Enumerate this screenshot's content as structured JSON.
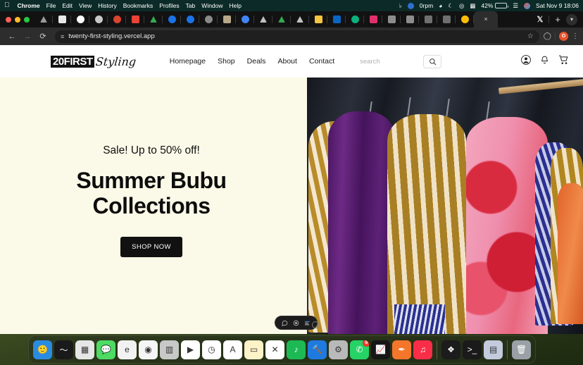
{
  "menubar": {
    "apple_icon": "apple-logo",
    "items": [
      "Chrome",
      "File",
      "Edit",
      "View",
      "History",
      "Bookmarks",
      "Profiles",
      "Tab",
      "Window",
      "Help"
    ],
    "status": {
      "music_rate": "0rpm",
      "battery_percent": "42%",
      "datetime": "Sat Nov 9  18:06",
      "icons": [
        "music-note-icon",
        "stats-icon",
        "clock-icon",
        "moon-icon",
        "record-icon",
        "keyboard-icon",
        "battery-icon",
        "display-icon",
        "control-center-icon"
      ]
    }
  },
  "browser": {
    "window_controls": [
      "close",
      "minimize",
      "zoom"
    ],
    "tabs": [
      {
        "name": "tab-apple",
        "color": "#9a9a9a",
        "shape": "triangle"
      },
      {
        "name": "tab-news",
        "color": "#e8e8e8",
        "shape": "square"
      },
      {
        "name": "tab-github",
        "color": "#ffffff",
        "shape": "circle"
      },
      {
        "name": "tab-app",
        "color": "#c8c8c8",
        "shape": "circle"
      },
      {
        "name": "tab-opera",
        "color": "#d8452f",
        "shape": "circle"
      },
      {
        "name": "tab-gmail",
        "color": "#ea4335",
        "shape": "square"
      },
      {
        "name": "tab-drive",
        "color": "#34a853",
        "shape": "triangle"
      },
      {
        "name": "tab-loop",
        "color": "#1a73e8",
        "shape": "circle"
      },
      {
        "name": "tab-loop2",
        "color": "#1a73e8",
        "shape": "circle"
      },
      {
        "name": "tab-gray",
        "color": "#8a8a8a",
        "shape": "circle"
      },
      {
        "name": "tab-photo",
        "color": "#b8a88a",
        "shape": "square"
      },
      {
        "name": "tab-chrome",
        "color": "#4285f4",
        "shape": "circle"
      },
      {
        "name": "tab-apple2",
        "color": "#c0c0c0",
        "shape": "triangle"
      },
      {
        "name": "tab-drive2",
        "color": "#34a853",
        "shape": "triangle"
      },
      {
        "name": "tab-apple3",
        "color": "#c0c0c0",
        "shape": "triangle"
      },
      {
        "name": "tab-note",
        "color": "#f5c542",
        "shape": "square"
      },
      {
        "name": "tab-linkedin",
        "color": "#0a66c2",
        "shape": "square"
      },
      {
        "name": "tab-hubspot",
        "color": "#0bb07b",
        "shape": "circle"
      },
      {
        "name": "tab-instagram",
        "color": "#e1306c",
        "shape": "square"
      },
      {
        "name": "tab-vp",
        "color": "#8d8d8d",
        "shape": "square"
      },
      {
        "name": "tab-vp2",
        "color": "#8d8d8d",
        "shape": "square"
      },
      {
        "name": "tab-dark1",
        "color": "#6f6f6f",
        "shape": "square"
      },
      {
        "name": "tab-dark2",
        "color": "#6f6f6f",
        "shape": "square"
      },
      {
        "name": "tab-google-photos",
        "color": "#fbbc04",
        "shape": "circle"
      }
    ],
    "active_tab_close_label": "×",
    "x_tab_label": "𝕏",
    "new_tab_label": "+",
    "tab_list_chevron": "▾",
    "nav": {
      "back": "←",
      "forward": "→",
      "reload": "⟳"
    },
    "omnibox": {
      "site_settings_icon": "tune-icon",
      "url": "twenty-first-styling.vercel.app",
      "bookmark_icon": "star-icon"
    },
    "toolbar_right": {
      "extensions_icon": "puzzle-icon",
      "profile_initial": "O",
      "menu_icon": "kebab-menu-icon"
    }
  },
  "site": {
    "logo": {
      "block_text": "20FIRST",
      "script_text": "Styling"
    },
    "nav_links": [
      "Homepage",
      "Shop",
      "Deals",
      "About",
      "Contact"
    ],
    "search": {
      "value": "",
      "placeholder": "search",
      "button_icon": "search-icon"
    },
    "header_icons": [
      "account-icon",
      "notification-bell-icon",
      "shopping-cart-icon"
    ],
    "hero": {
      "eyebrow": "Sale! Up to 50% off!",
      "title": "Summer Bubu Collections",
      "cta_label": "SHOP NOW",
      "bg_color": "#fbfae8",
      "image_alt": "clothing rack of patterned bubu garments"
    }
  },
  "vercel_toolbar": {
    "icons": [
      "comment-icon",
      "inspect-icon",
      "menu-icon"
    ]
  },
  "dock": {
    "apps": [
      {
        "name": "finder",
        "glyph": "🙂",
        "bg": "#2a8ce0",
        "running": true
      },
      {
        "name": "audio-editor",
        "glyph": "〜",
        "bg": "#1a1a1a",
        "running": false
      },
      {
        "name": "launchpad",
        "glyph": "▦",
        "bg": "#e6e6e6",
        "running": false
      },
      {
        "name": "messages",
        "glyph": "💬",
        "bg": "#4ddb63",
        "running": false
      },
      {
        "name": "microsoft-edge",
        "glyph": "e",
        "bg": "#f2f2f2",
        "running": false
      },
      {
        "name": "google-chrome",
        "glyph": "◉",
        "bg": "#f5f5f5",
        "running": true
      },
      {
        "name": "calculator",
        "glyph": "▥",
        "bg": "#c8c8c8",
        "running": false
      },
      {
        "name": "youtube-music",
        "glyph": "▶",
        "bg": "#ffffff",
        "running": false
      },
      {
        "name": "clock",
        "glyph": "◷",
        "bg": "#ffffff",
        "running": false
      },
      {
        "name": "arc-browser",
        "glyph": "A",
        "bg": "#ffffff",
        "running": false
      },
      {
        "name": "notes",
        "glyph": "▭",
        "bg": "#fdf3c8",
        "running": true
      },
      {
        "name": "visual-studio-code",
        "glyph": "✕",
        "bg": "#ffffff",
        "running": true
      },
      {
        "name": "spotify",
        "glyph": "♪",
        "bg": "#1db954",
        "running": false
      },
      {
        "name": "xcode",
        "glyph": "🔨",
        "bg": "#1f7ae0",
        "running": false
      },
      {
        "name": "system-settings",
        "glyph": "⚙",
        "bg": "#b9b9b9",
        "running": false
      },
      {
        "name": "whatsapp",
        "glyph": "✆",
        "bg": "#25d366",
        "running": true,
        "badge": "6"
      },
      {
        "name": "activity-monitor",
        "glyph": "📈",
        "bg": "#161616",
        "running": false
      },
      {
        "name": "preview",
        "glyph": "✒",
        "bg": "#f4762a",
        "running": false
      },
      {
        "name": "music",
        "glyph": "♫",
        "bg": "#fa2d48",
        "running": false
      },
      {
        "name": "figma",
        "glyph": "❖",
        "bg": "#1c1c1c",
        "running": true
      },
      {
        "name": "terminal",
        "glyph": ">_",
        "bg": "#1a1a1a",
        "running": true
      },
      {
        "name": "downloads-stack",
        "glyph": "▤",
        "bg": "#c3cbdd",
        "running": false
      },
      {
        "name": "trash",
        "glyph": "🗑",
        "bg": "#9aa0a6",
        "running": false
      }
    ]
  }
}
